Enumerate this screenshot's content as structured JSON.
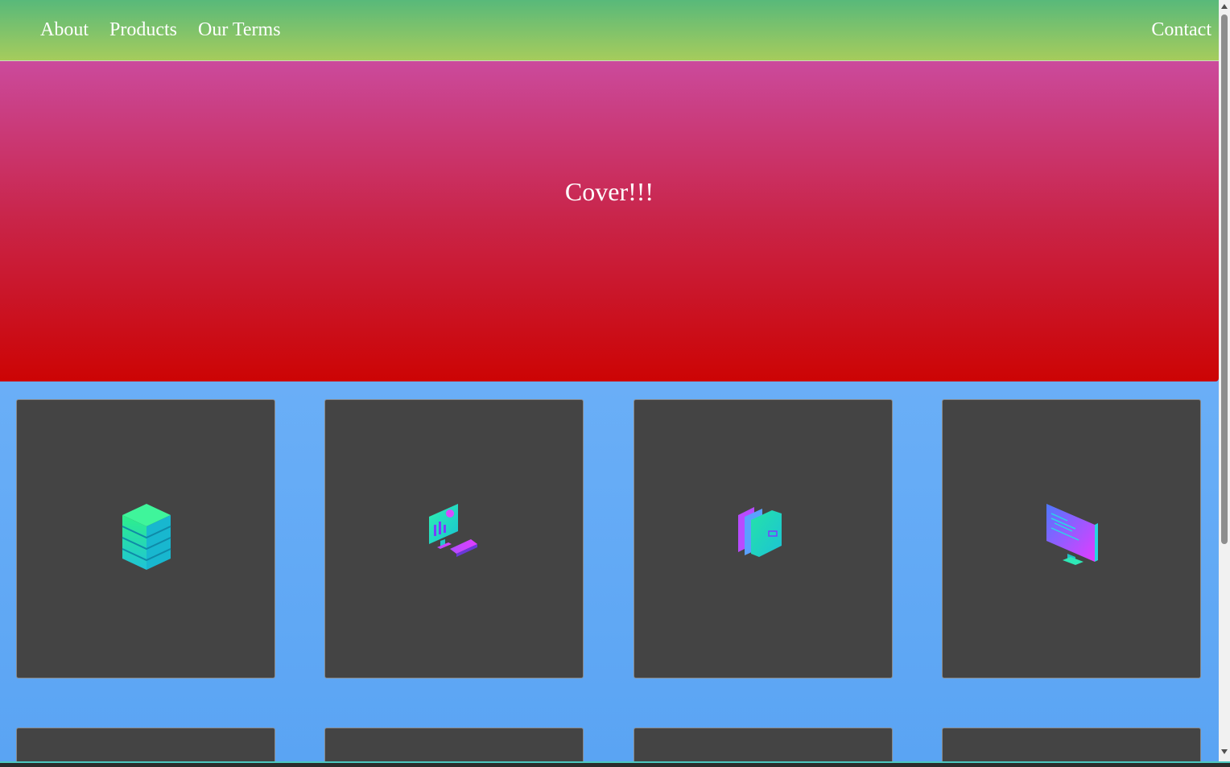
{
  "nav": {
    "left_links": [
      "About",
      "Products",
      "Our Terms"
    ],
    "right_link": "Contact"
  },
  "cover": {
    "title": "Cover!!!"
  },
  "cards": [
    {
      "icon": "database-stack-icon"
    },
    {
      "icon": "desktop-analytics-icon"
    },
    {
      "icon": "folders-icon"
    },
    {
      "icon": "code-monitor-icon"
    }
  ],
  "colors": {
    "nav_gradient": [
      "#58b97a",
      "#a6cc5c"
    ],
    "cover_gradient": [
      "#cb4a9c",
      "#c92448",
      "#cc0404"
    ],
    "page_gradient": [
      "#7ab9fb",
      "#5aa4f3"
    ],
    "card": "#444444"
  }
}
